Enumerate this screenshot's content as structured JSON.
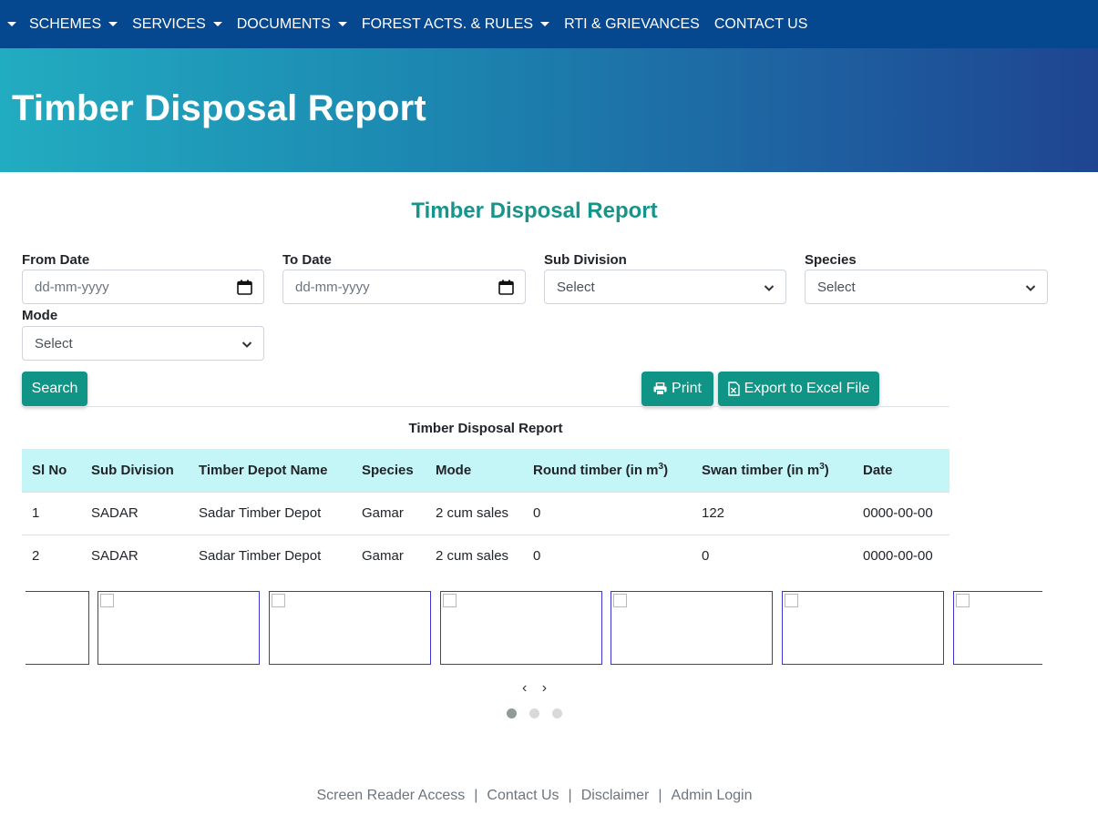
{
  "nav": {
    "items": [
      {
        "label": "SCHEMES"
      },
      {
        "label": "SERVICES"
      },
      {
        "label": "DOCUMENTS"
      },
      {
        "label": "FOREST ACTS. & RULES"
      },
      {
        "label": "RTI & GRIEVANCES"
      },
      {
        "label": "CONTACT US"
      }
    ]
  },
  "banner": {
    "title": "Timber Disposal Report"
  },
  "section_title": "Timber Disposal Report",
  "filters": {
    "from_date": {
      "label": "From Date",
      "placeholder": "dd-mm-yyyy"
    },
    "to_date": {
      "label": "To Date",
      "placeholder": "dd-mm-yyyy"
    },
    "sub_division": {
      "label": "Sub Division",
      "value": "Select"
    },
    "species": {
      "label": "Species",
      "value": "Select"
    },
    "mode": {
      "label": "Mode",
      "value": "Select"
    }
  },
  "buttons": {
    "search": "Search",
    "print": "Print",
    "export": "Export to Excel File"
  },
  "table": {
    "caption": "Timber Disposal Report",
    "headers": [
      "Sl No",
      "Sub Division",
      "Timber Depot Name",
      "Species",
      "Mode",
      "Round timber (in m",
      "Swan timber (in m",
      "Date"
    ],
    "superscript": "3",
    "rows": [
      [
        "1",
        "SADAR",
        "Sadar Timber Depot",
        "Gamar",
        "2 cum sales",
        "0",
        "122",
        "0000-00-00"
      ],
      [
        "2",
        "SADAR",
        "Sadar Timber Depot",
        "Gamar",
        "2 cum sales",
        "0",
        "0",
        "0000-00-00"
      ]
    ]
  },
  "carousel": {
    "arrows": "‹ ›",
    "active_dot": 0,
    "dot_count": 3
  },
  "footer": {
    "links": [
      "Screen Reader Access",
      "Contact Us",
      "Disclaimer",
      "Admin Login"
    ],
    "separator": "|"
  },
  "colors": {
    "nav_bg": "#06488f",
    "accent": "#0f9485",
    "title_teal": "#17958a",
    "table_header_bg": "#c5f6f7"
  }
}
